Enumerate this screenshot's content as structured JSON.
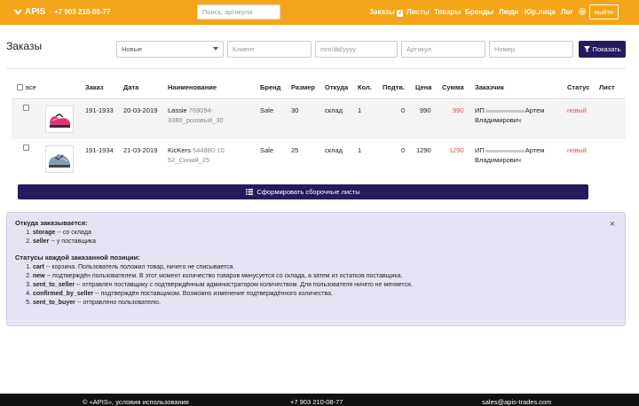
{
  "header": {
    "brand": "APIS",
    "phone": "+7 903 210-08-77",
    "search_placeholder": "Поиск, артикула",
    "nav": [
      {
        "label": "Заказы",
        "badge": "2"
      },
      {
        "label": "Листы"
      },
      {
        "label": "Товары"
      },
      {
        "label": "Бренды"
      },
      {
        "label": "Люди"
      },
      {
        "label": "Юр.лица"
      },
      {
        "label": "Лог"
      }
    ],
    "logout_label": "выйти"
  },
  "page": {
    "title": "Заказы"
  },
  "filters": {
    "status_value": "Новые",
    "client_placeholder": "Клиент",
    "date_placeholder": "mm/dd/yyyy",
    "article_placeholder": "Артикул",
    "number_placeholder": "Номер",
    "show_label": "Показать"
  },
  "table": {
    "select_all_label": "все",
    "columns": [
      "Заказ",
      "Дата",
      "Наименование",
      "Бренд",
      "Размер",
      "Откуда",
      "Кол.",
      "Подтв.",
      "Цена",
      "Сумма",
      "Заказчик",
      "Статус",
      "Лист"
    ],
    "rows": [
      {
        "order": "191-1933",
        "date": "20-03-2019",
        "name": "Lassie",
        "sku_1": "769094-",
        "sku_2": "3380_розовый_30",
        "brand": "Sale",
        "size": "30",
        "from": "склад",
        "qty": "1",
        "confirmed": "0",
        "price": "990",
        "sum": "990",
        "customer_1": "ИП",
        "customer_1b": "Артем",
        "customer_2": "Владимирович",
        "status": "новый"
      },
      {
        "order": "191-1934",
        "date": "21-03-2019",
        "name": "KicKers",
        "sku_1": "544880-10",
        "sku_2": "52_Синий_25",
        "brand": "Sale",
        "size": "25",
        "from": "склад",
        "qty": "1",
        "confirmed": "0",
        "price": "1290",
        "sum": "1290",
        "customer_1": "ИП",
        "customer_1b": "Артем",
        "customer_2": "Владимирович",
        "status": "новый"
      }
    ]
  },
  "actions": {
    "make_sheets_label": "Сформировать сборочные листы"
  },
  "info": {
    "source_heading": "Откуда заказывается:",
    "sources": [
      {
        "key": "storage",
        "text": " -- со склада"
      },
      {
        "key": "seller",
        "text": " -- у поставщика"
      }
    ],
    "status_heading": "Статусы каждой заказанной позиции:",
    "statuses": [
      {
        "key": "cart",
        "text": " -- корзина. Пользователь положил товар, ничего не списывается."
      },
      {
        "key": "new",
        "text": " -- подтверждён пользователем. В этот момент количество товаров минусуется со склада, а затем из остатков поставщика."
      },
      {
        "key": "sent_to_seller",
        "text": " -- отправлен поставщику с подтверждённым администратором количеством. Для пользователя ничего не меняется."
      },
      {
        "key": "confirmed_by_seller",
        "text": " -- подтверждён поставщиком. Возможно изменение подтверждённого количества."
      },
      {
        "key": "sent_to_buyer",
        "text": " -- отправлено пользователю."
      }
    ],
    "close_symbol": "×"
  },
  "footer": {
    "copyright": "© «APIS», условия использования",
    "phone": "+7 903 210-08-77",
    "email": "sales@apis-trades.com"
  },
  "colors": {
    "accent": "#f4a519",
    "primary": "#241c5c",
    "info_bg": "#e6e4f4",
    "status_new": "#d9534f"
  }
}
